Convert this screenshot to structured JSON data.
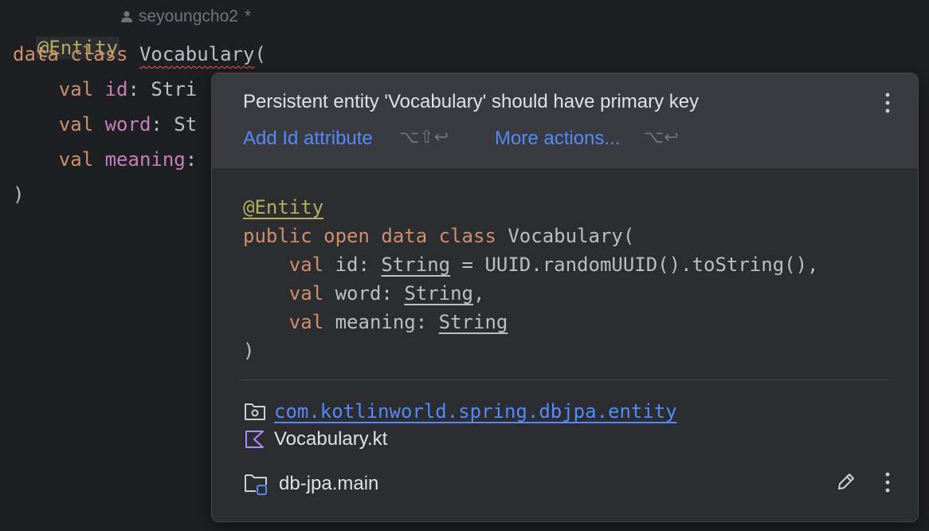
{
  "editor": {
    "annotation": "@Entity",
    "author": "seyoungcho2",
    "author_modified_marker": "*",
    "line2": {
      "kw1": "data",
      "kw2": "class",
      "name": "Vocabulary",
      "paren": "("
    },
    "line3": {
      "kw": "val",
      "prop": "id",
      "rest": ": Stri"
    },
    "line4": {
      "kw": "val",
      "prop": "word",
      "rest": ": St"
    },
    "line5": {
      "kw": "val",
      "prop": "meaning",
      "rest": ":"
    },
    "line6": ")"
  },
  "popup": {
    "problem": "Persistent entity 'Vocabulary' should have primary key",
    "actions": [
      {
        "label": "Add Id attribute",
        "shortcut": "⌥⇧↩"
      },
      {
        "label": "More actions...",
        "shortcut": "⌥↩"
      }
    ],
    "code": {
      "annotation": "@Entity",
      "line2": {
        "public": "public",
        "open": "open",
        "data": "data",
        "class": "class",
        "name": "Vocabulary("
      },
      "line3": {
        "val": "val",
        "name": "id: ",
        "type": "String",
        "rest": " = UUID.randomUUID().toString(),"
      },
      "line4": {
        "val": "val",
        "name": "word: ",
        "type": "String",
        "rest": ","
      },
      "line5": {
        "val": "val",
        "name": "meaning: ",
        "type": "String"
      },
      "line6": ")"
    },
    "package": "com.kotlinworld.spring.dbjpa.entity",
    "file": "Vocabulary.kt",
    "module": "db-jpa.main"
  },
  "icons": [
    "person-icon",
    "kebab-menu-icon",
    "folder-package-icon",
    "kotlin-file-icon",
    "module-folder-icon",
    "pencil-icon"
  ],
  "colors": {
    "background": "#1e1f22",
    "popup": "#2b2d30",
    "popup_header": "#393b40",
    "keyword": "#cf8e6d",
    "property": "#c77dbb",
    "annotation": "#b3ae60",
    "link": "#548af7",
    "error": "#f75464"
  }
}
